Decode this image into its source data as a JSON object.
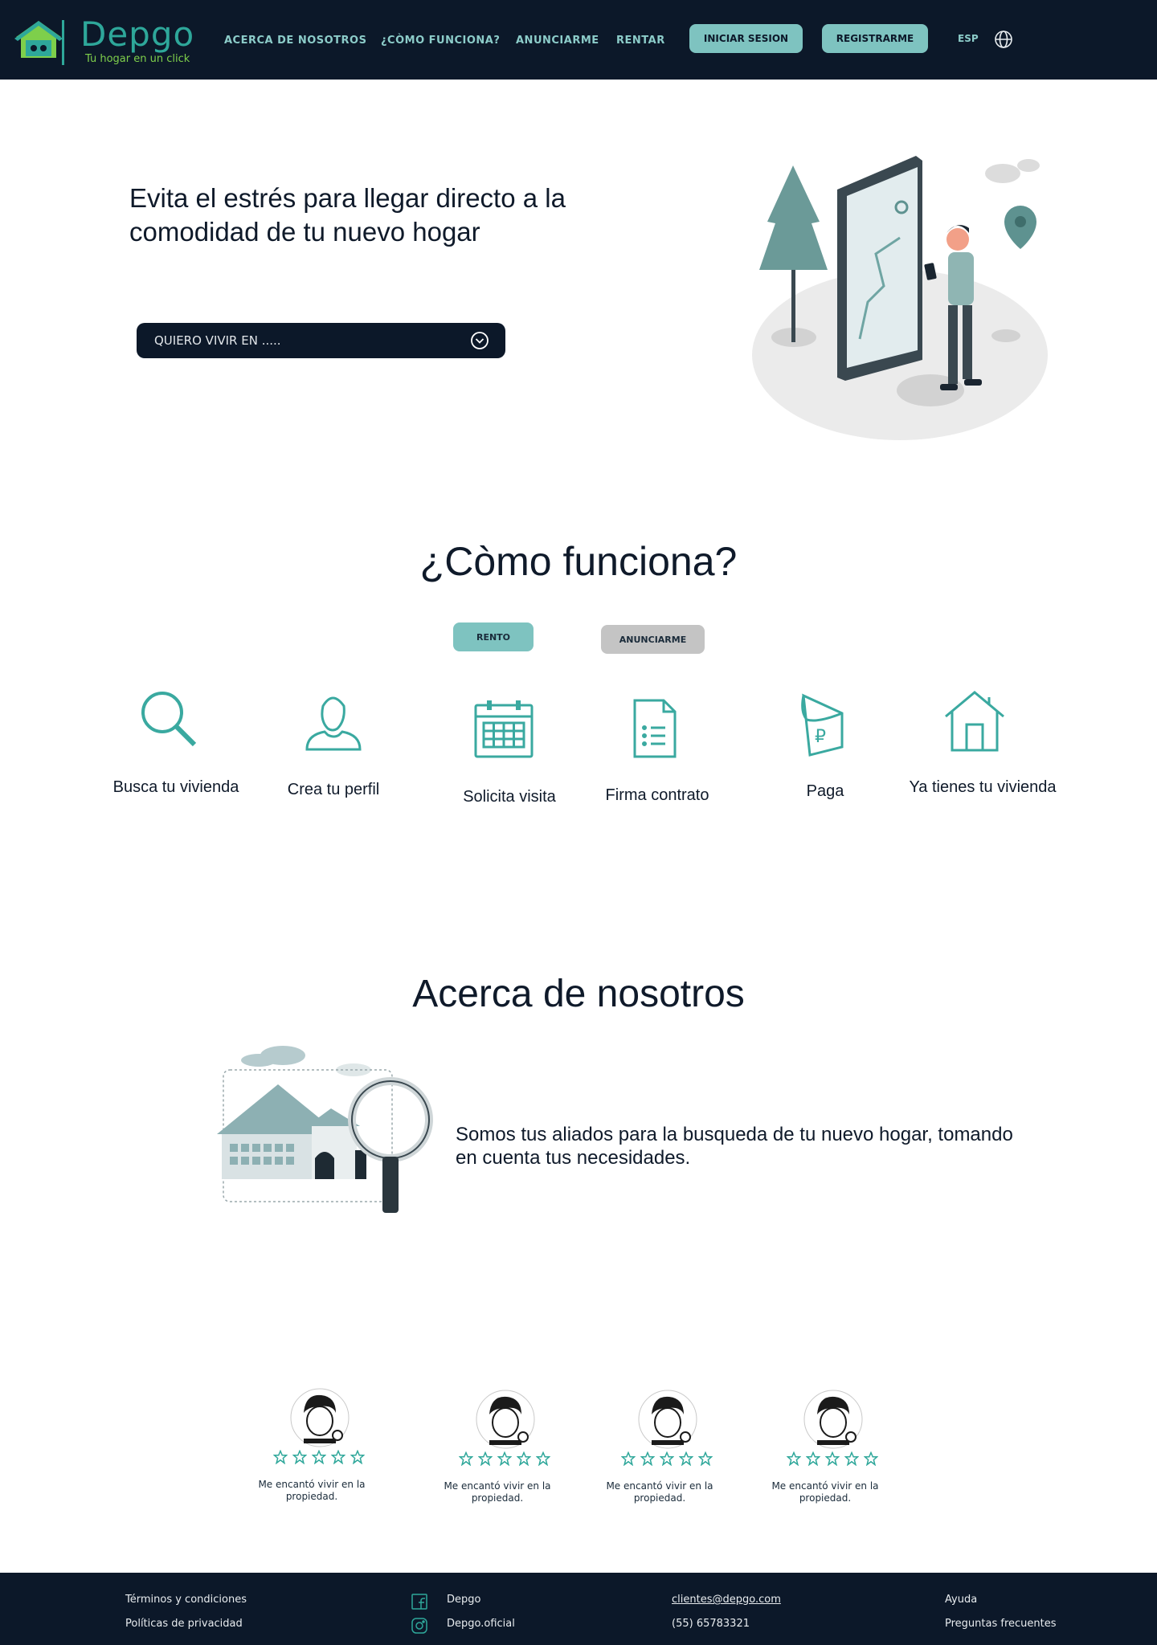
{
  "header": {
    "brand": "Depgo",
    "tagline": "Tu hogar en un click",
    "nav": [
      "ACERCA DE NOSOTROS",
      "¿CÒMO FUNCIONA?",
      "ANUNCIARME",
      "RENTAR"
    ],
    "login_label": "INICIAR SESION",
    "register_label": "REGISTRARME",
    "language": "ESP"
  },
  "hero": {
    "title": "Evita el estrés para llegar directo a la comodidad de tu nuevo hogar",
    "search_placeholder": "QUIERO VIVIR EN ....."
  },
  "how": {
    "title": "¿Còmo funciona?",
    "tabs": [
      "RENTO",
      "ANUNCIARME"
    ],
    "steps": [
      {
        "label": "Busca tu vivienda",
        "icon": "search-icon"
      },
      {
        "label": "Crea tu perfil",
        "icon": "user-icon"
      },
      {
        "label": "Solicita  visita",
        "icon": "calendar-icon"
      },
      {
        "label": "Firma contrato",
        "icon": "document-icon"
      },
      {
        "label": "Paga",
        "icon": "wallet-icon"
      },
      {
        "label": "Ya tienes tu vivienda",
        "icon": "house-icon"
      }
    ]
  },
  "about": {
    "title": "Acerca de nosotros",
    "text": "Somos tus aliados para la busqueda de tu nuevo hogar, tomando en cuenta tus necesidades."
  },
  "reviews": [
    {
      "rating": 5,
      "text": "Me encantó vivir en la propiedad."
    },
    {
      "rating": 5,
      "text": "Me encantó vivir en la propiedad."
    },
    {
      "rating": 5,
      "text": "Me encantó vivir en la propiedad."
    },
    {
      "rating": 5,
      "text": "Me encantó vivir en la propiedad."
    }
  ],
  "footer": {
    "terms": "Términos y condiciones",
    "privacy": "Políticas  de privacidad",
    "facebook": "Depgo",
    "instagram": "Depgo.oficial",
    "email": "clientes@depgo.com",
    "phone": "(55) 65783321",
    "help": "Ayuda",
    "faq": "Preguntas frecuentes"
  },
  "colors": {
    "navy": "#0c1829",
    "teal": "#2ea79a",
    "accent_button": "#7ec3c0",
    "tab_inactive": "#c4c4c4"
  }
}
